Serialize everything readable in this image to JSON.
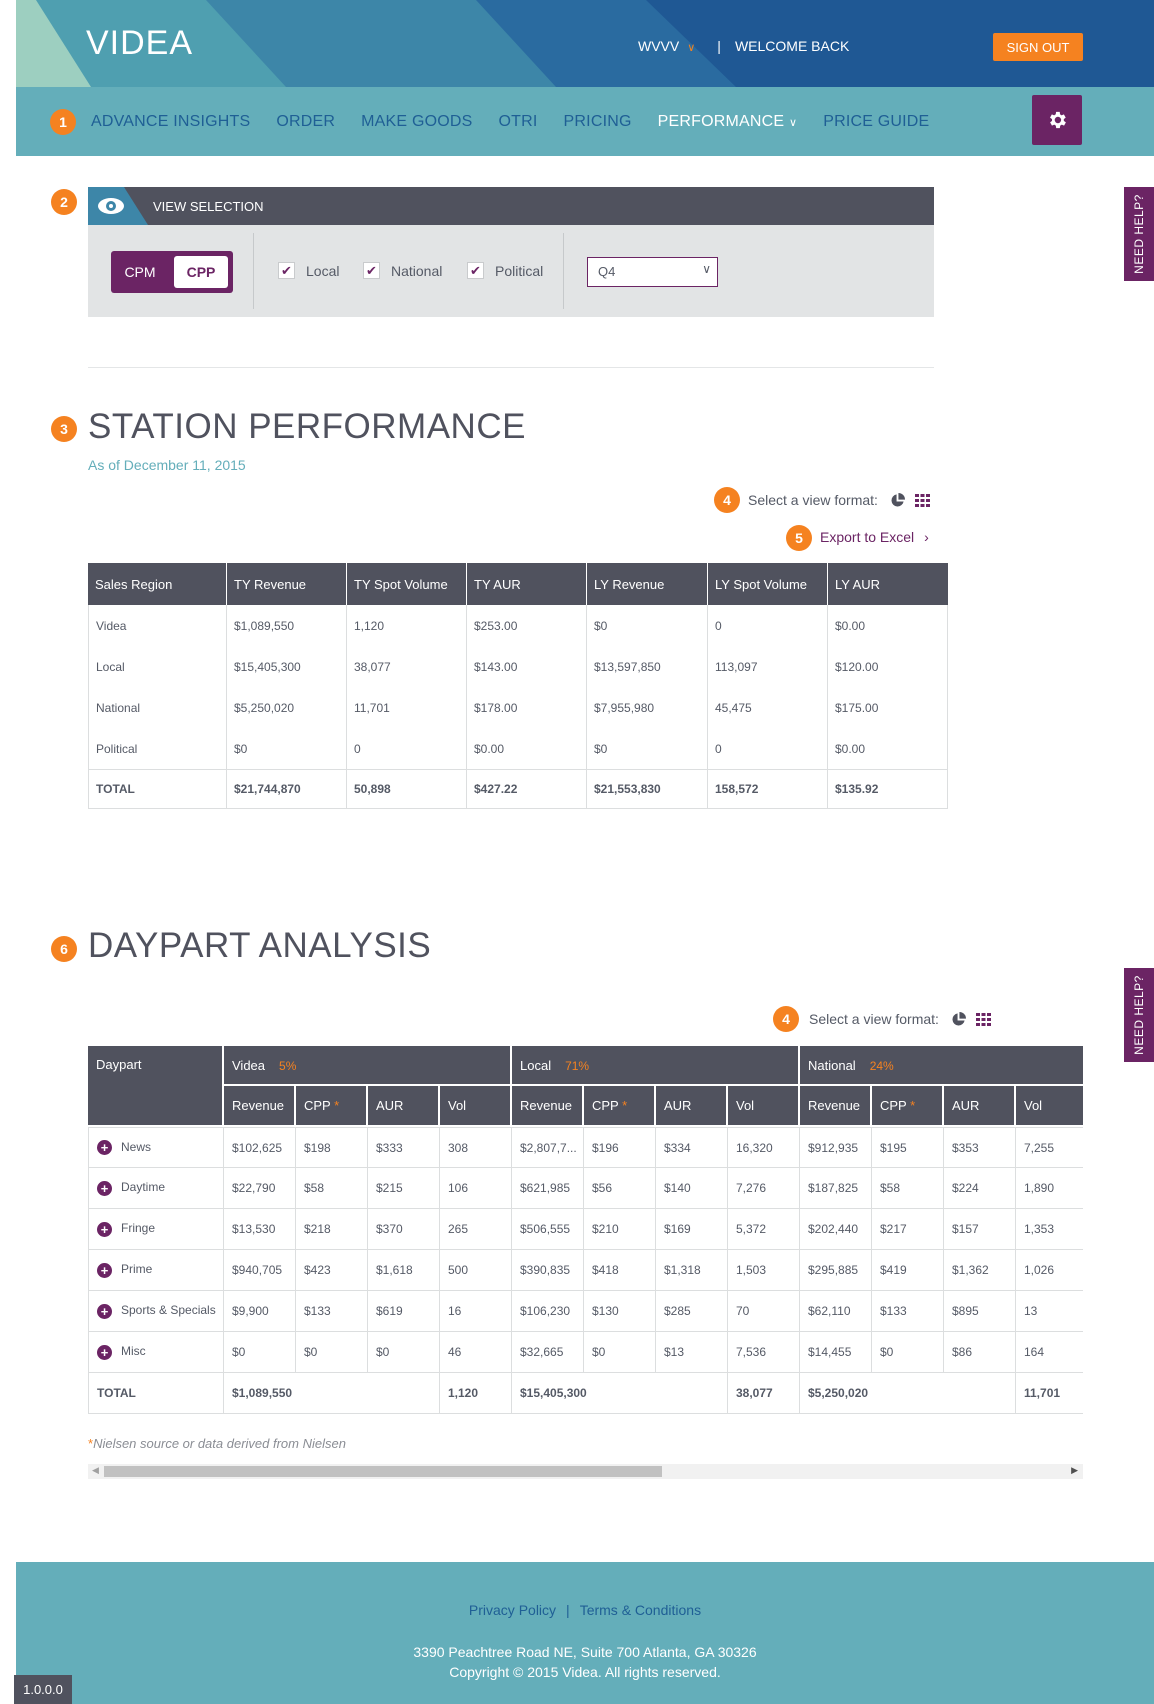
{
  "header": {
    "logo_text": "VIDEA",
    "station": "WVVV",
    "separator": "|",
    "welcome": "WELCOME BACK",
    "sign_out": "SIGN OUT"
  },
  "nav": {
    "badge": "1",
    "items": [
      "ADVANCE INSIGHTS",
      "ORDER",
      "MAKE GOODS",
      "OTRI",
      "PRICING",
      "PERFORMANCE",
      "PRICE GUIDE"
    ],
    "active": "PERFORMANCE"
  },
  "need_help": "NEED HELP?",
  "view_selection": {
    "badge": "2",
    "title": "VIEW SELECTION",
    "toggle_off": "CPM",
    "toggle_on": "CPP",
    "checkboxes": [
      "Local",
      "National",
      "Political"
    ],
    "quarter": "Q4"
  },
  "station_performance": {
    "badge": "3",
    "title": "STATION PERFORMANCE",
    "as_of": "As of December 11, 2015",
    "format_badge": "4",
    "format_label": "Select a view format:",
    "export_badge": "5",
    "export_label": "Export to Excel",
    "columns": [
      "Sales Region",
      "TY Revenue",
      "TY Spot Volume",
      "TY AUR",
      "LY Revenue",
      "LY Spot Volume",
      "LY AUR"
    ],
    "rows": [
      [
        "Videa",
        "$1,089,550",
        "1,120",
        "$253.00",
        "$0",
        "0",
        "$0.00"
      ],
      [
        "Local",
        "$15,405,300",
        "38,077",
        "$143.00",
        "$13,597,850",
        "113,097",
        "$120.00"
      ],
      [
        "National",
        "$5,250,020",
        "11,701",
        "$178.00",
        "$7,955,980",
        "45,475",
        "$175.00"
      ],
      [
        "Political",
        "$0",
        "0",
        "$0.00",
        "$0",
        "0",
        "$0.00"
      ]
    ],
    "total": [
      "TOTAL",
      "$21,744,870",
      "50,898",
      "$427.22",
      "$21,553,830",
      "158,572",
      "$135.92"
    ]
  },
  "daypart": {
    "badge": "6",
    "title": "DAYPART ANALYSIS",
    "format_badge": "4",
    "format_label": "Select a view format:",
    "first_col": "Daypart",
    "groups": [
      {
        "name": "Videa",
        "pct": "5%"
      },
      {
        "name": "Local",
        "pct": "71%"
      },
      {
        "name": "National",
        "pct": "24%"
      }
    ],
    "sub_cols": [
      "Revenue",
      "CPP",
      "AUR",
      "Vol"
    ],
    "star": "*",
    "rows": [
      {
        "name": "News",
        "cells": [
          "$102,625",
          "$198",
          "$333",
          "308",
          "$2,807,7...",
          "$196",
          "$334",
          "16,320",
          "$912,935",
          "$195",
          "$353",
          "7,255"
        ]
      },
      {
        "name": "Daytime",
        "cells": [
          "$22,790",
          "$58",
          "$215",
          "106",
          "$621,985",
          "$56",
          "$140",
          "7,276",
          "$187,825",
          "$58",
          "$224",
          "1,890"
        ]
      },
      {
        "name": "Fringe",
        "cells": [
          "$13,530",
          "$218",
          "$370",
          "265",
          "$506,555",
          "$210",
          "$169",
          "5,372",
          "$202,440",
          "$217",
          "$157",
          "1,353"
        ]
      },
      {
        "name": "Prime",
        "cells": [
          "$940,705",
          "$423",
          "$1,618",
          "500",
          "$390,835",
          "$418",
          "$1,318",
          "1,503",
          "$295,885",
          "$419",
          "$1,362",
          "1,026"
        ]
      },
      {
        "name": "Sports & Specials",
        "cells": [
          "$9,900",
          "$133",
          "$619",
          "16",
          "$106,230",
          "$130",
          "$285",
          "70",
          "$62,110",
          "$133",
          "$895",
          "13"
        ]
      },
      {
        "name": "Misc",
        "cells": [
          "$0",
          "$0",
          "$0",
          "46",
          "$32,665",
          "$0",
          "$13",
          "7,536",
          "$14,455",
          "$0",
          "$86",
          "164"
        ]
      }
    ],
    "total": {
      "label": "TOTAL",
      "videa_rev": "$1,089,550",
      "videa_vol": "1,120",
      "local_rev": "$15,405,300",
      "local_vol": "38,077",
      "national_rev": "$5,250,020",
      "national_vol": "11,701"
    },
    "note_star": "*",
    "note": "Nielsen source or data derived from Nielsen"
  },
  "footer": {
    "privacy": "Privacy Policy",
    "sep": "|",
    "terms": "Terms & Conditions",
    "address": "3390 Peachtree Road NE, Suite 700 Atlanta, GA 30326",
    "copyright": "Copyright © 2015 Videa. All rights reserved."
  },
  "version": "1.0.0.0",
  "colors": {
    "brand_purple": "#6b2464",
    "accent_orange": "#f58220",
    "teal": "#64aeba",
    "navy": "#1f5f95",
    "dark_gray": "#50525e"
  }
}
